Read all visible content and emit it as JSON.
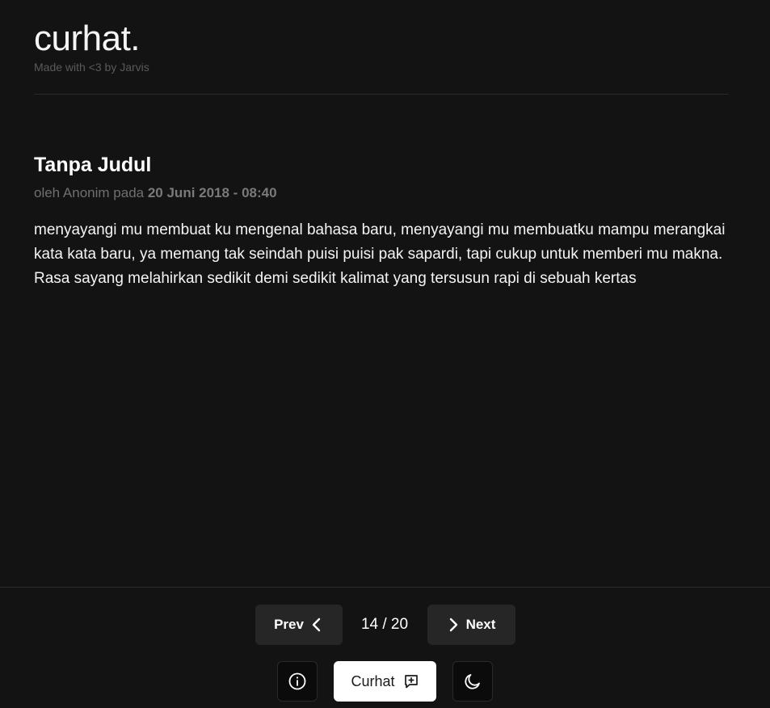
{
  "header": {
    "brand": "curhat.",
    "tagline": "Made with <3 by Jarvis"
  },
  "post": {
    "title": "Tanpa Judul",
    "meta_prefix": "oleh Anonim pada ",
    "date": "20 Juni 2018 - 08:40",
    "body": "menyayangi mu membuat ku mengenal bahasa baru, menyayangi mu membuatku mampu merangkai kata kata baru, ya memang tak seindah puisi puisi pak sapardi, tapi cukup untuk memberi mu makna. Rasa sayang melahirkan sedikit demi sedikit kalimat yang tersusun rapi di sebuah kertas"
  },
  "pagination": {
    "prev_label": "Prev",
    "next_label": "Next",
    "indicator": "14 / 20",
    "current": 14,
    "total": 20
  },
  "actions": {
    "curhat_label": "Curhat",
    "info_icon": "info-icon",
    "new_post_icon": "message-plus-icon",
    "theme_icon": "moon-icon"
  },
  "colors": {
    "background": "#131313",
    "button_dark": "#262626",
    "button_light": "#ffffff",
    "text_primary": "#ffffff",
    "text_muted": "#6f6f6f"
  }
}
